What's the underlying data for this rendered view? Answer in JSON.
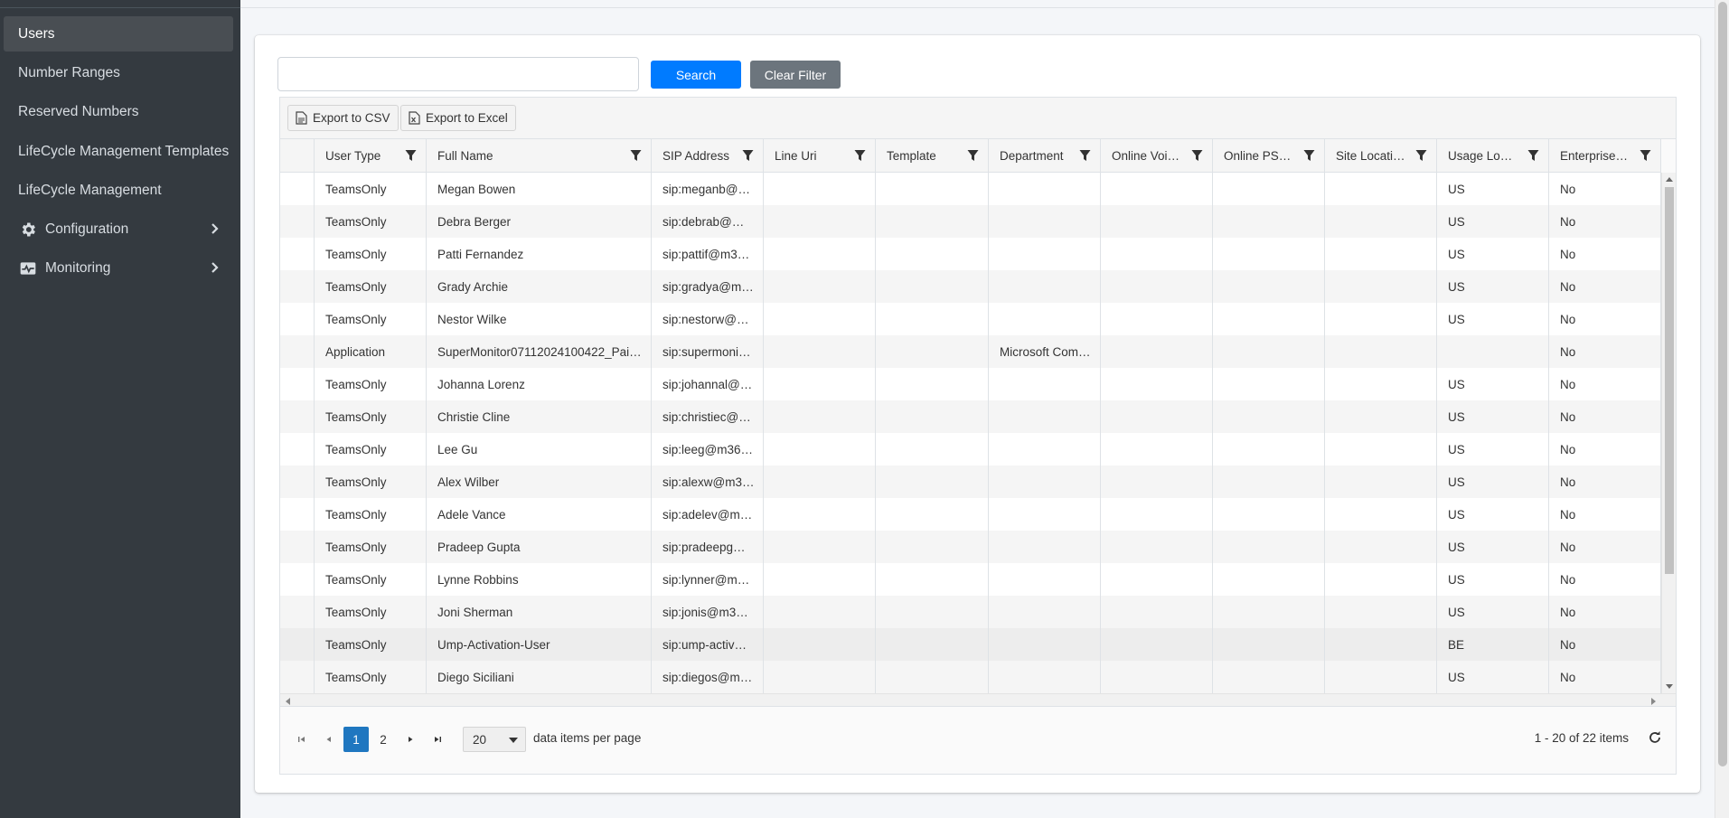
{
  "sidebar": {
    "items": [
      {
        "label": "Users",
        "active": true
      },
      {
        "label": "Number Ranges"
      },
      {
        "label": "Reserved Numbers"
      },
      {
        "label": "LifeCycle Management Templates"
      },
      {
        "label": "LifeCycle Management"
      },
      {
        "label": "Configuration",
        "icon": "gear-icon",
        "expandable": true
      },
      {
        "label": "Monitoring",
        "icon": "monitoring-icon",
        "expandable": true
      }
    ]
  },
  "search": {
    "value": "",
    "button_label": "Search",
    "clear_label": "Clear Filter"
  },
  "toolbar": {
    "export_csv": "Export to CSV",
    "export_excel": "Export to Excel"
  },
  "columns": [
    "",
    "User Type",
    "Full Name",
    "SIP Address",
    "Line Uri",
    "Template",
    "Department",
    "Online Voi…",
    "Online PST…",
    "Site Location",
    "Usage Loc…",
    "Enterprise…"
  ],
  "rows": [
    [
      "TeamsOnly",
      "Megan Bowen",
      "sip:meganb@…",
      "",
      "",
      "",
      "",
      "",
      "",
      "US",
      "No"
    ],
    [
      "TeamsOnly",
      "Debra Berger",
      "sip:debrab@…",
      "",
      "",
      "",
      "",
      "",
      "",
      "US",
      "No"
    ],
    [
      "TeamsOnly",
      "Patti Fernandez",
      "sip:pattif@m3…",
      "",
      "",
      "",
      "",
      "",
      "",
      "US",
      "No"
    ],
    [
      "TeamsOnly",
      "Grady Archie",
      "sip:gradya@m…",
      "",
      "",
      "",
      "",
      "",
      "",
      "US",
      "No"
    ],
    [
      "TeamsOnly",
      "Nestor Wilke",
      "sip:nestorw@…",
      "",
      "",
      "",
      "",
      "",
      "",
      "US",
      "No"
    ],
    [
      "Application",
      "SuperMonitor07112024100422_Paired",
      "sip:supermoni…",
      "",
      "",
      "Microsoft Com…",
      "",
      "",
      "",
      "",
      "No"
    ],
    [
      "TeamsOnly",
      "Johanna Lorenz",
      "sip:johannal@…",
      "",
      "",
      "",
      "",
      "",
      "",
      "US",
      "No"
    ],
    [
      "TeamsOnly",
      "Christie Cline",
      "sip:christiec@…",
      "",
      "",
      "",
      "",
      "",
      "",
      "US",
      "No"
    ],
    [
      "TeamsOnly",
      "Lee Gu",
      "sip:leeg@m36…",
      "",
      "",
      "",
      "",
      "",
      "",
      "US",
      "No"
    ],
    [
      "TeamsOnly",
      "Alex Wilber",
      "sip:alexw@m3…",
      "",
      "",
      "",
      "",
      "",
      "",
      "US",
      "No"
    ],
    [
      "TeamsOnly",
      "Adele Vance",
      "sip:adelev@m…",
      "",
      "",
      "",
      "",
      "",
      "",
      "US",
      "No"
    ],
    [
      "TeamsOnly",
      "Pradeep Gupta",
      "sip:pradeepg…",
      "",
      "",
      "",
      "",
      "",
      "",
      "US",
      "No"
    ],
    [
      "TeamsOnly",
      "Lynne Robbins",
      "sip:lynner@m…",
      "",
      "",
      "",
      "",
      "",
      "",
      "US",
      "No"
    ],
    [
      "TeamsOnly",
      "Joni Sherman",
      "sip:jonis@m3…",
      "",
      "",
      "",
      "",
      "",
      "",
      "US",
      "No"
    ],
    [
      "TeamsOnly",
      "Ump-Activation-User",
      "sip:ump-activ…",
      "",
      "",
      "",
      "",
      "",
      "",
      "BE",
      "No"
    ],
    [
      "TeamsOnly",
      "Diego Siciliani",
      "sip:diegos@m…",
      "",
      "",
      "",
      "",
      "",
      "",
      "US",
      "No"
    ]
  ],
  "pager": {
    "pages": [
      "1",
      "2"
    ],
    "current": "1",
    "page_size": "20",
    "page_size_label": "data items per page",
    "info": "1 - 20 of 22 items"
  },
  "colors": {
    "sidebar_bg": "#343a40",
    "primary": "#007bff",
    "secondary": "#6c757d",
    "pager_active": "#1f77c0"
  }
}
